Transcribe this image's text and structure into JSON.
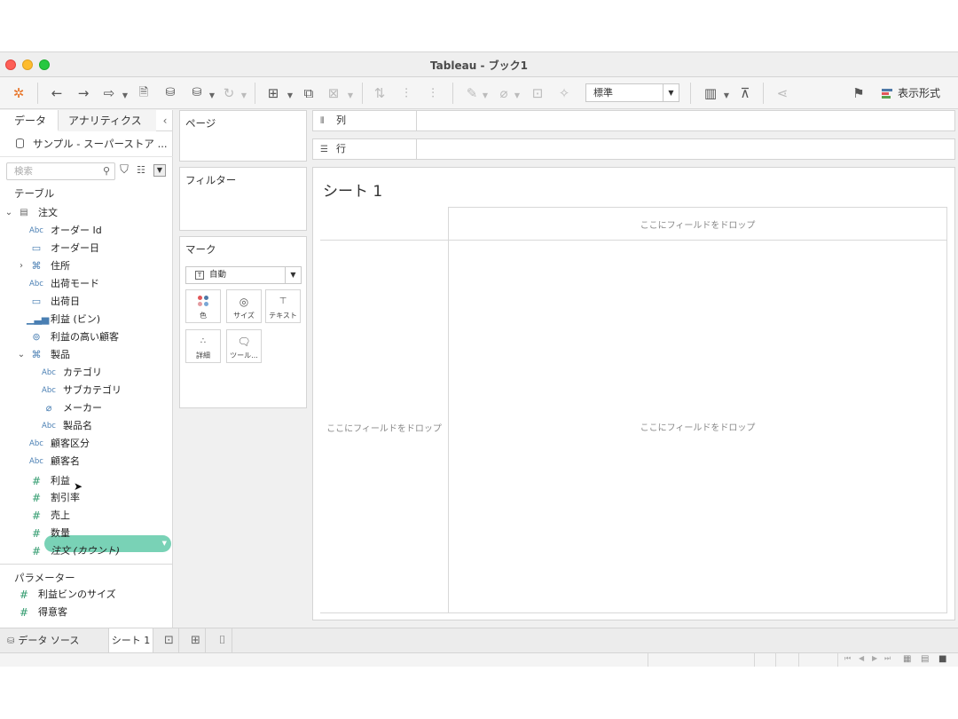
{
  "window": {
    "title": "Tableau - ブック1"
  },
  "toolbar": {
    "icons": [
      "tableau-logo-icon",
      "back-icon",
      "forward-icon",
      "connect-icon",
      "save-icon",
      "new-datasource-icon",
      "pause-updates-icon",
      "refresh-icon",
      "new-worksheet-icon",
      "duplicate-icon",
      "clear-icon",
      "swap-icon",
      "sort-asc-icon",
      "sort-desc-icon",
      "highlight-icon",
      "group-icon",
      "labels-icon",
      "pin-icon",
      "presentation-icon",
      "share-icon",
      "tooltip-icon"
    ],
    "fit_value": "標準",
    "show_me_label": "表示形式",
    "show_me_colors": [
      "#4e79a7",
      "#e15759",
      "#59a14f"
    ]
  },
  "data_pane": {
    "tab_data": "データ",
    "tab_analytics": "アナリティクス",
    "datasource": "サンプル - スーパーストア ...",
    "search_placeholder": "検索",
    "tables_header": "テーブル",
    "table_name": "注文",
    "fields": [
      {
        "icon": "Abc",
        "label": "オーダー Id"
      },
      {
        "icon": "日",
        "label": "オーダー日"
      },
      {
        "icon": "品",
        "label": "住所"
      },
      {
        "icon": "Abc",
        "label": "出荷モード"
      },
      {
        "icon": "日",
        "label": "出荷日"
      },
      {
        "icon": ".ıl",
        "label": "利益 (ビン)"
      },
      {
        "icon": "⊘",
        "label": "利益の高い顧客"
      },
      {
        "icon": "品",
        "label": "製品"
      },
      {
        "icon": "Abc",
        "label": "カテゴリ"
      },
      {
        "icon": "Abc",
        "label": "サブカテゴリ"
      },
      {
        "icon": "⌀",
        "label": "メーカー"
      },
      {
        "icon": "Abc",
        "label": "製品名"
      },
      {
        "icon": "Abc",
        "label": "顧客区分"
      },
      {
        "icon": "Abc",
        "label": "顧客名"
      },
      {
        "icon": "#",
        "label": "利益"
      },
      {
        "icon": "#",
        "label": "割引率"
      },
      {
        "icon": "#",
        "label": "売上"
      },
      {
        "icon": "#",
        "label": "数量"
      },
      {
        "icon": "#",
        "label": "注文 (カウント)"
      }
    ],
    "parameters_header": "パラメーター",
    "parameters": [
      {
        "icon": "#",
        "label": "利益ビンのサイズ"
      },
      {
        "icon": "#",
        "label": "得意客"
      }
    ]
  },
  "cards": {
    "pages": "ページ",
    "filters": "フィルター",
    "marks": "マーク",
    "mark_type": "自動",
    "mark_buttons": [
      "色",
      "サイズ",
      "テキスト",
      "詳細",
      "ツール..."
    ]
  },
  "shelves": {
    "columns": "列",
    "rows": "行"
  },
  "sheet": {
    "title": "シート 1",
    "drop_top": "ここにフィールドをドロップ",
    "drop_left": "ここにフィールドをドロップ",
    "drop_center": "ここにフィールドをドロップ"
  },
  "bottom": {
    "datasource_tab": "データ ソース",
    "sheet_tab": "シート 1"
  }
}
